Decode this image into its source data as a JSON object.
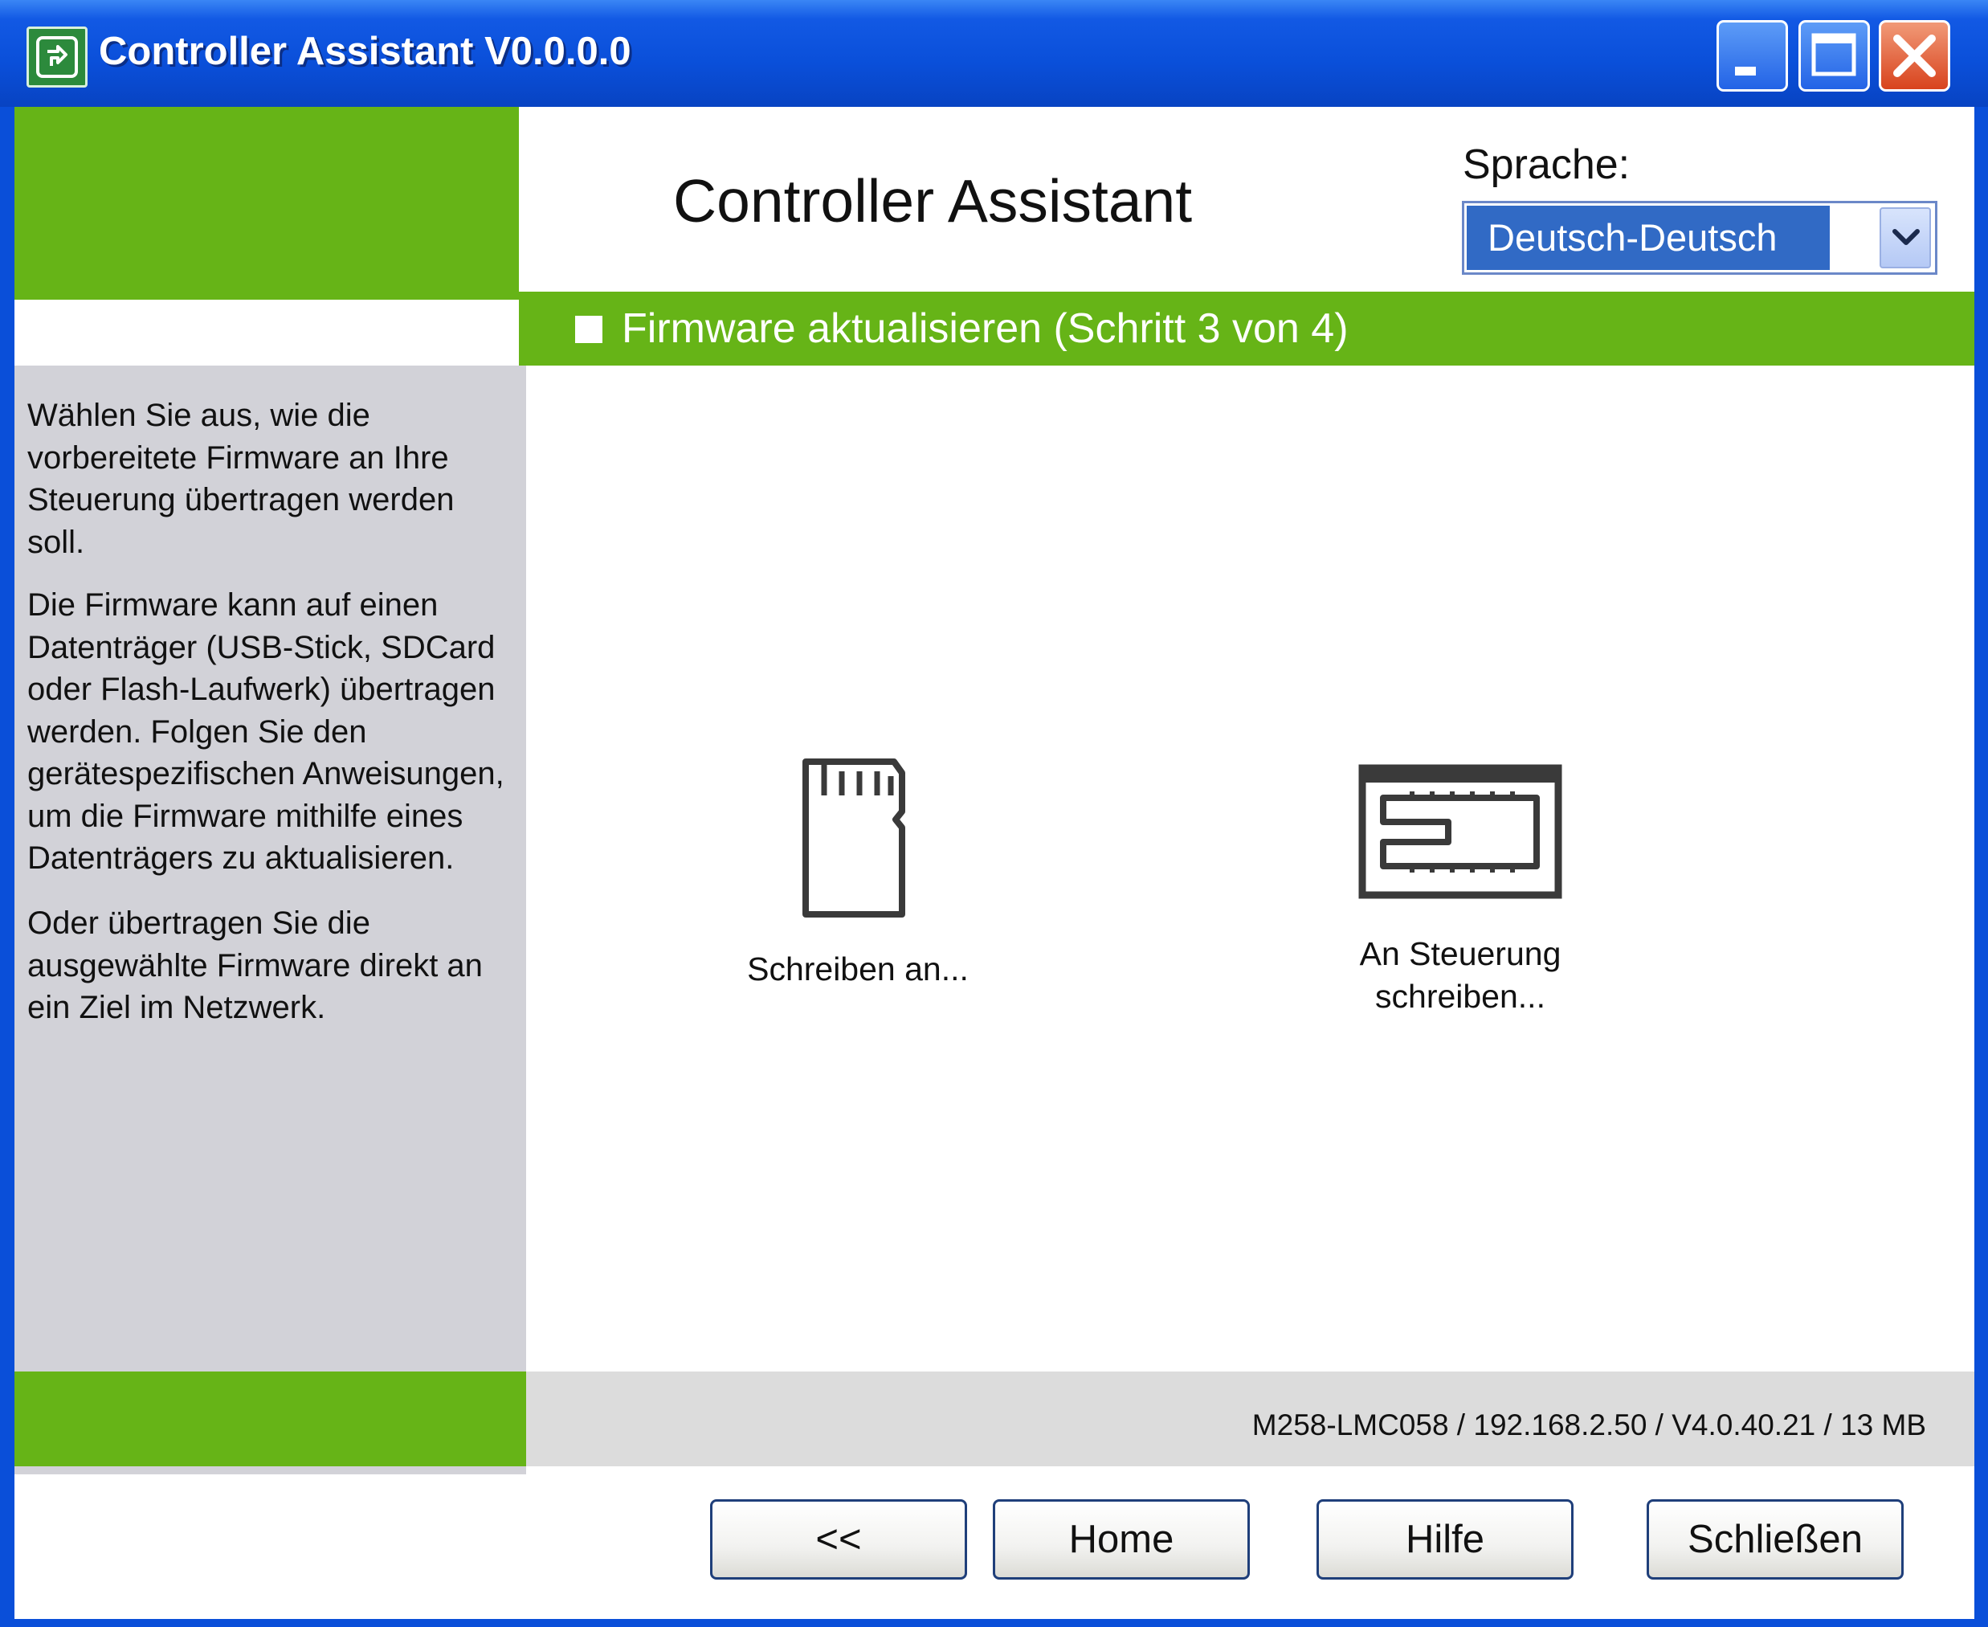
{
  "window": {
    "title": "Controller Assistant V0.0.0.0",
    "titlebar_color": "#0a4fd9"
  },
  "header": {
    "title": "Controller Assistant",
    "language_label": "Sprache:",
    "language_selected": "Deutsch-Deutsch"
  },
  "step": {
    "label": "Firmware aktualisieren (Schritt 3 von 4)",
    "accent_color": "#66b417"
  },
  "sidebar": {
    "paragraphs": [
      "Wählen Sie aus, wie die vorbereitete Firmware an Ihre Steuerung übertragen werden soll.",
      "Die Firmware kann auf einen Datenträger (USB-Stick, SDCard oder Flash-Laufwerk) übertragen werden. Folgen Sie den gerätespezifischen Anweisungen, um die Firmware mithilfe eines Datenträgers zu aktualisieren.",
      "Oder übertragen Sie die ausgewählte Firmware direkt an ein Ziel im Netzwerk."
    ]
  },
  "options": [
    {
      "icon": "sd-card-icon",
      "label_line1": "Schreiben an...",
      "label_line2": ""
    },
    {
      "icon": "controller-icon",
      "label_line1": "An Steuerung",
      "label_line2": "schreiben..."
    }
  ],
  "status": {
    "text": "M258-LMC058 / 192.168.2.50 / V4.0.40.21 / 13 MB"
  },
  "buttons": {
    "back": "<<",
    "home": "Home",
    "help": "Hilfe",
    "close": "Schließen"
  }
}
